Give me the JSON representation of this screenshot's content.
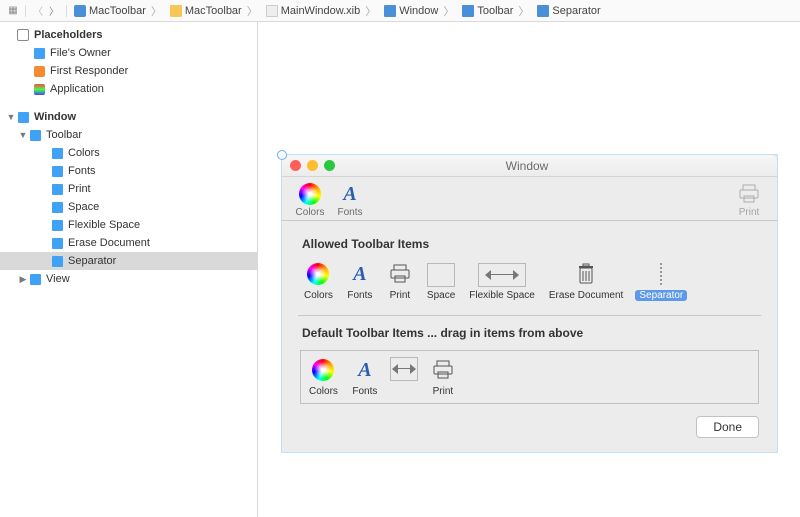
{
  "breadcrumb": {
    "items": [
      {
        "label": "MacToolbar"
      },
      {
        "label": "MacToolbar"
      },
      {
        "label": "MainWindow.xib"
      },
      {
        "label": "Window"
      },
      {
        "label": "Toolbar"
      },
      {
        "label": "Separator"
      }
    ]
  },
  "outline": {
    "placeholders_title": "Placeholders",
    "files_owner": "File's Owner",
    "first_responder": "First Responder",
    "application": "Application",
    "window": "Window",
    "toolbar": "Toolbar",
    "items": {
      "colors": "Colors",
      "fonts": "Fonts",
      "print": "Print",
      "space": "Space",
      "flexible_space": "Flexible Space",
      "erase_document": "Erase Document",
      "separator": "Separator"
    },
    "view": "View"
  },
  "window": {
    "title": "Window",
    "toolbar": {
      "colors": "Colors",
      "fonts": "Fonts",
      "print": "Print"
    },
    "panel": {
      "allowed_title": "Allowed Toolbar Items",
      "default_title": "Default Toolbar Items ... drag in items from above",
      "done": "Done",
      "allowed": {
        "colors": "Colors",
        "fonts": "Fonts",
        "print": "Print",
        "space": "Space",
        "flexible_space": "Flexible Space",
        "erase_document": "Erase Document",
        "separator": "Separator"
      },
      "default": {
        "colors": "Colors",
        "fonts": "Fonts",
        "flexible_space": "",
        "print": "Print"
      }
    }
  }
}
